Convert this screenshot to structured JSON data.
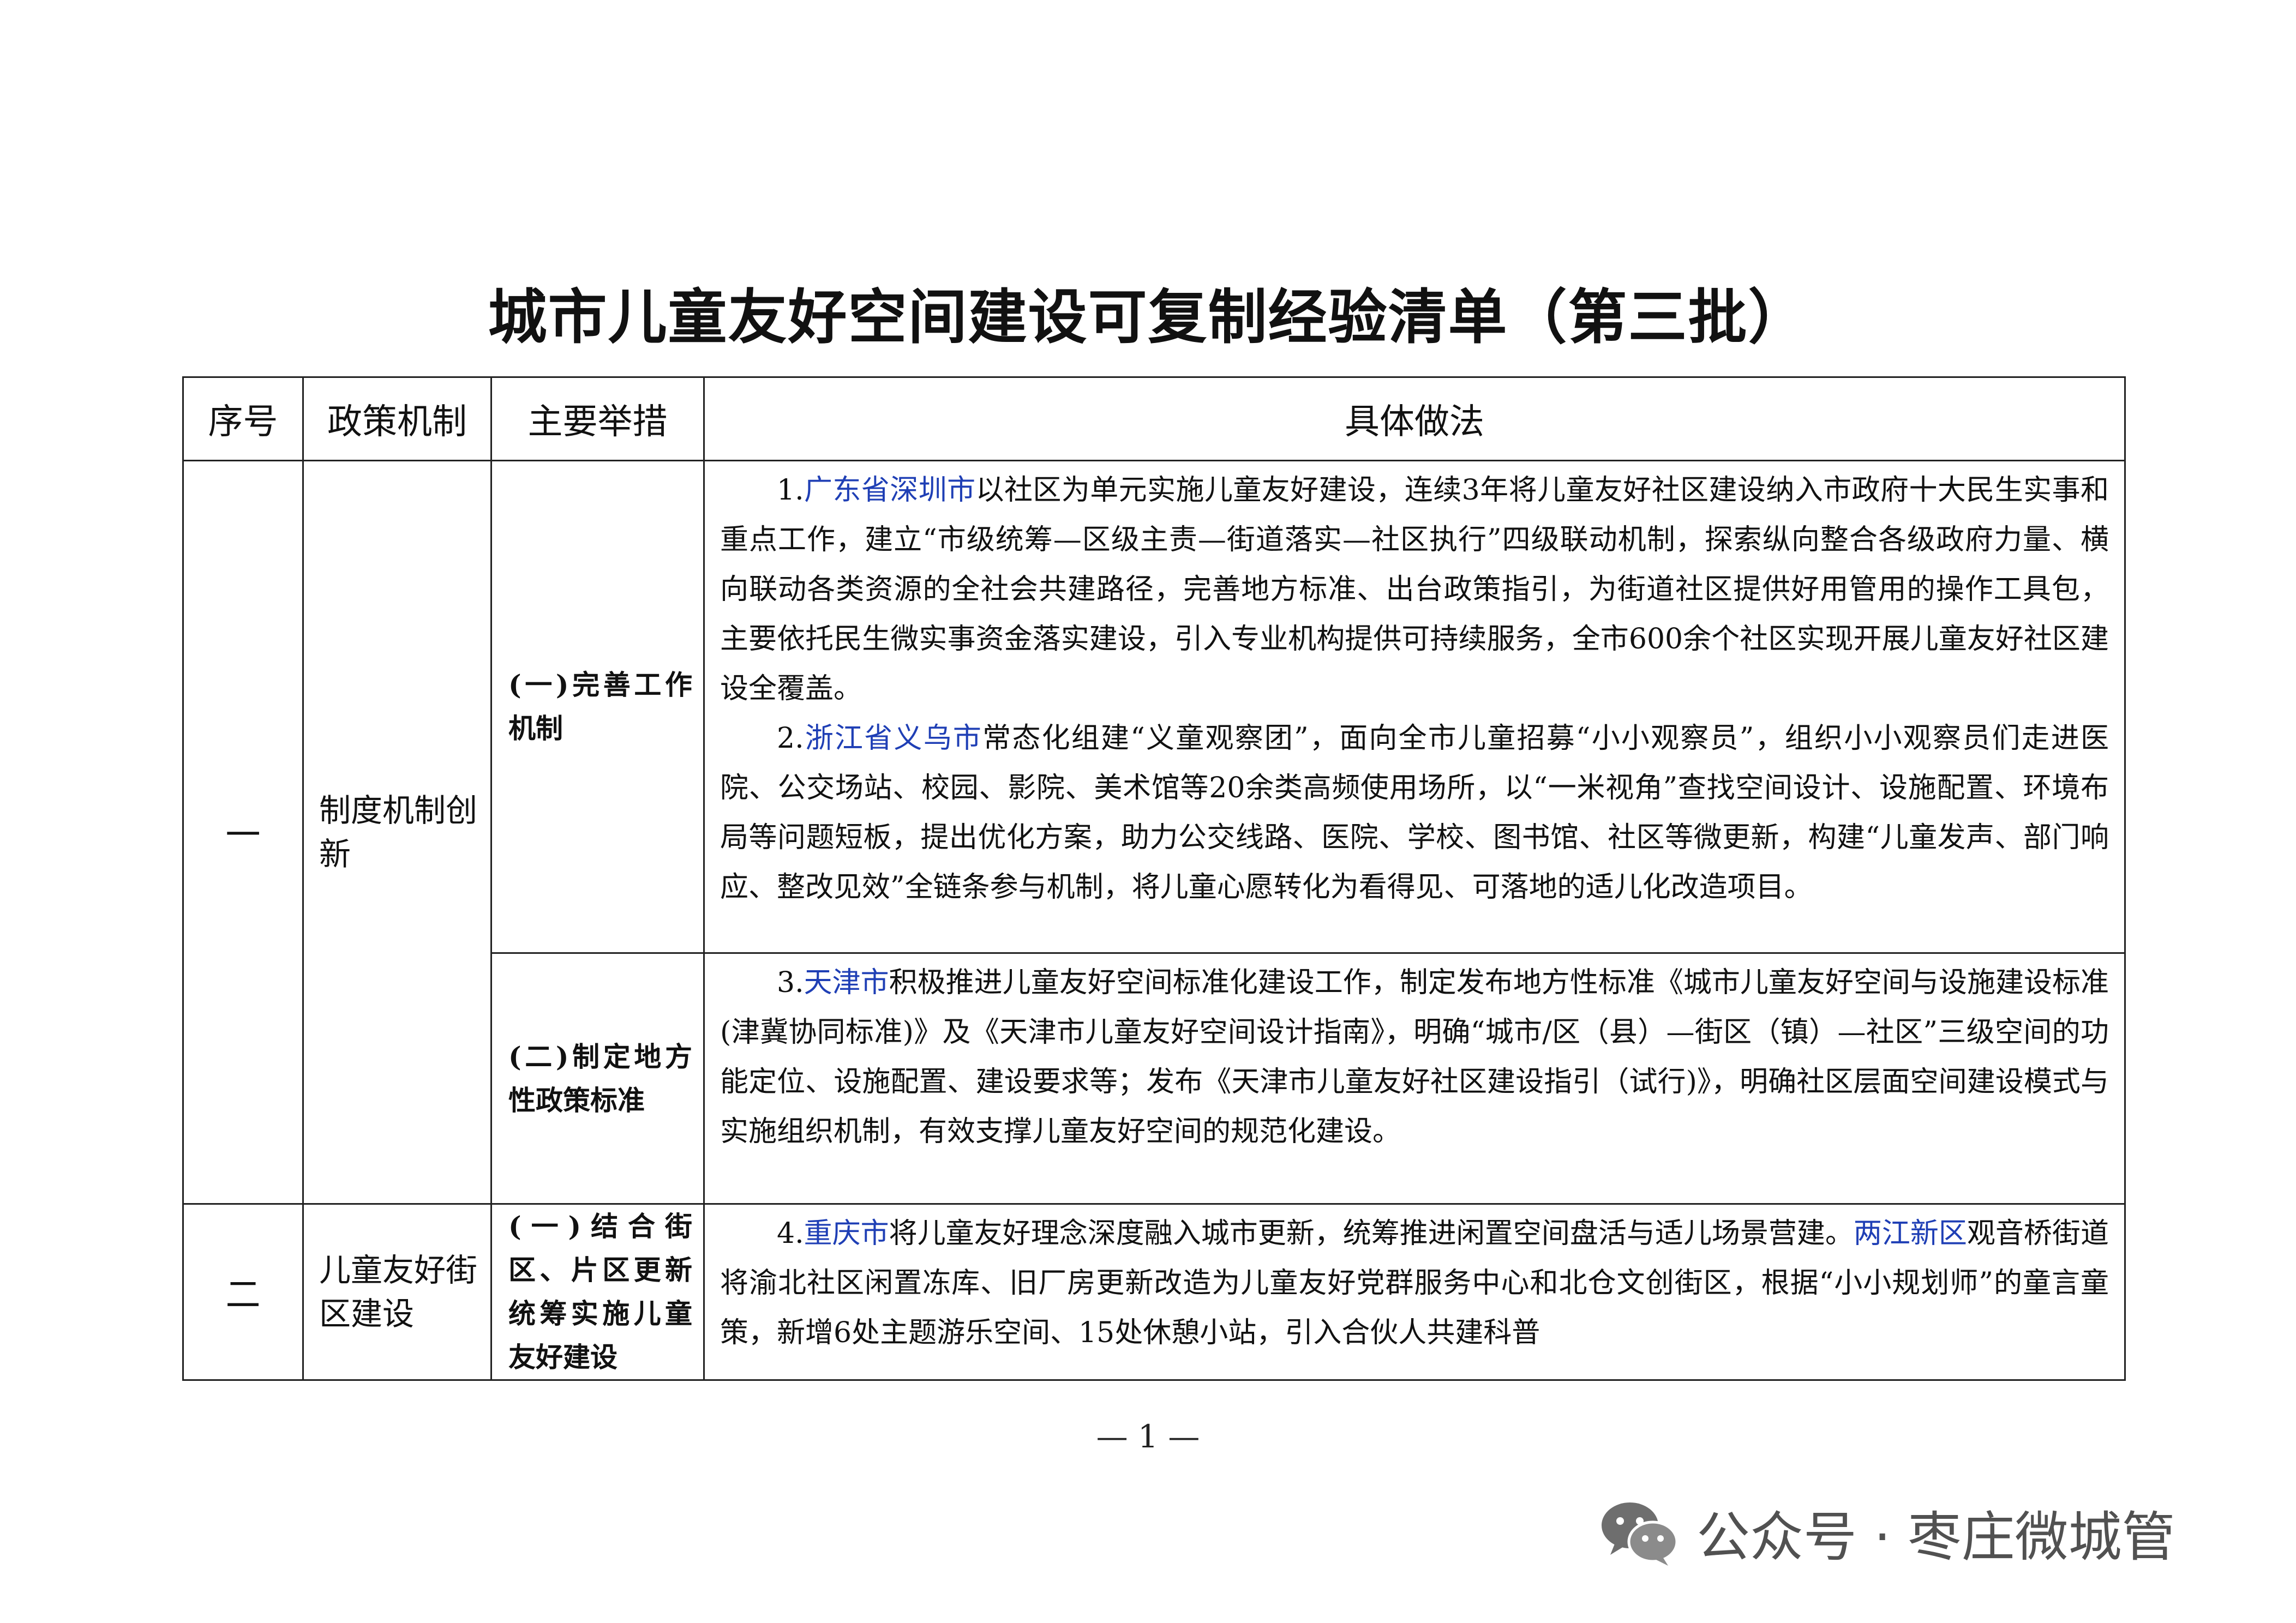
{
  "title": "城市儿童友好空间建设可复制经验清单（第三批）",
  "table": {
    "headers": [
      "序号",
      "政策机制",
      "主要举措",
      "具体做法"
    ],
    "group1": {
      "seq": "一",
      "policy": "制度机制创新",
      "measure1": "(一)完善工作机制",
      "item1": {
        "num": "1.",
        "place": "广东省深圳市",
        "text": "以社区为单元实施儿童友好建设，连续3年将儿童友好社区建设纳入市政府十大民生实事和重点工作，建立“市级统筹—区级主责—街道落实—社区执行”四级联动机制，探索纵向整合各级政府力量、横向联动各类资源的全社会共建路径，完善地方标准、出台政策指引，为街道社区提供好用管用的操作工具包，主要依托民生微实事资金落实建设，引入专业机构提供可持续服务，全市600余个社区实现开展儿童友好社区建设全覆盖。"
      },
      "item2": {
        "num": "2.",
        "place": "浙江省义乌市",
        "text": "常态化组建“义童观察团”，面向全市儿童招募“小小观察员”，组织小小观察员们走进医院、公交场站、校园、影院、美术馆等20余类高频使用场所，以“一米视角”查找空间设计、设施配置、环境布局等问题短板，提出优化方案，助力公交线路、医院、学校、图书馆、社区等微更新，构建“儿童发声、部门响应、整改见效”全链条参与机制，将儿童心愿转化为看得见、可落地的适儿化改造项目。"
      },
      "measure2": "(二)制定地方性政策标准",
      "item3": {
        "num": "3.",
        "place": "天津市",
        "text": "积极推进儿童友好空间标准化建设工作，制定发布地方性标准《城市儿童友好空间与设施建设标准(津冀协同标准)》及《天津市儿童友好空间设计指南》，明确“城市/区（县）—街区（镇）—社区”三级空间的功能定位、设施配置、建设要求等；发布《天津市儿童友好社区建设指引（试行)》，明确社区层面空间建设模式与实施组织机制，有效支撑儿童友好空间的规范化建设。"
      }
    },
    "group2": {
      "seq": "二",
      "policy": "儿童友好街区建设",
      "measure": "(一)结合街区、片区更新统筹实施儿童友好建设",
      "item4": {
        "num": "4.",
        "place": "重庆市",
        "text_a": "将儿童友好理念深度融入城市更新，统筹推进闲置空间盘活与适儿场景营建。",
        "place2": "两江新区",
        "text_b": "观音桥街道将渝北社区闲置冻库、旧厂房更新改造为儿童友好党群服务中心和北仓文创街区，根据“小小规划师”的童言童策，新增6处主题游乐空间、15处休憩小站，引入合伙人共建科普"
      }
    }
  },
  "page_number": "— 1 —",
  "watermark": {
    "icon": "wechat-icon",
    "text": "公众号 · 枣庄微城管"
  }
}
